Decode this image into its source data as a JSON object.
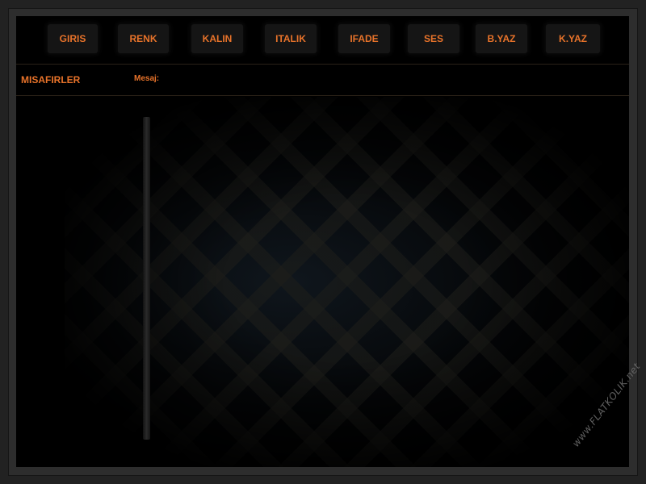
{
  "toolbar": {
    "buttons": [
      {
        "label": "GIRIS"
      },
      {
        "label": "RENK"
      },
      {
        "label": "KALIN"
      },
      {
        "label": "ITALIK"
      },
      {
        "label": "IFADE"
      },
      {
        "label": "SES"
      },
      {
        "label": "B.YAZ"
      },
      {
        "label": "K.YAZ"
      }
    ]
  },
  "guests": {
    "title": "MISAFIRLER"
  },
  "message": {
    "label": "Mesaj:",
    "value": ""
  },
  "watermark": {
    "text": "www.FLATKOLIK.net"
  },
  "colors": {
    "accent": "#e8732a",
    "background": "#000000",
    "frame": "#2d2d2d"
  }
}
